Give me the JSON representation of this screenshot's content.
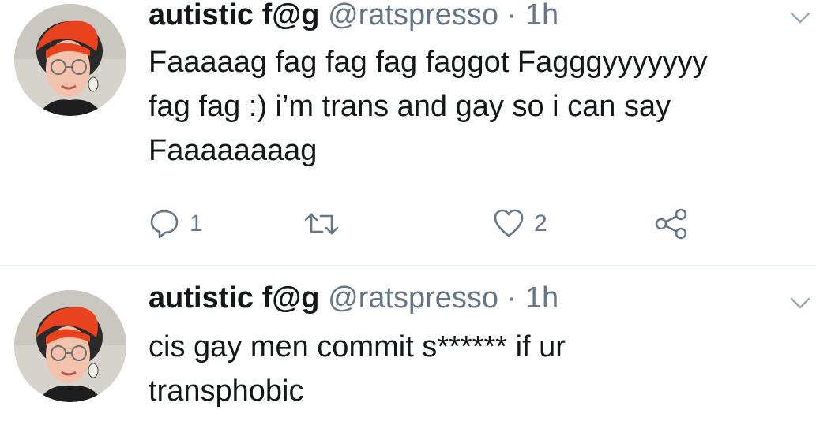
{
  "tweets": [
    {
      "author": {
        "name": "autistic f@g",
        "handle": "@ratspresso"
      },
      "separator": "·",
      "time": "1h",
      "lines": [
        "Faaaaag fag fag fag faggot Fagggyyyyyyy",
        "fag fag :) i’m trans and gay so i can say",
        "Faaaaaaaag"
      ],
      "actions": {
        "reply_count": "1",
        "retweet_count": "",
        "like_count": "2"
      },
      "icons": [
        "reply-icon",
        "retweet-icon",
        "like-icon",
        "share-icon",
        "chevron-down-icon"
      ]
    },
    {
      "author": {
        "name": "autistic f@g",
        "handle": "@ratspresso"
      },
      "separator": "·",
      "time": "1h",
      "lines": [
        "cis gay men commit s****** if ur",
        "transphobic"
      ],
      "icons": [
        "chevron-down-icon"
      ]
    }
  ],
  "colors": {
    "text": "#14171a",
    "secondary": "#657786",
    "divider": "#e6ecf0"
  }
}
